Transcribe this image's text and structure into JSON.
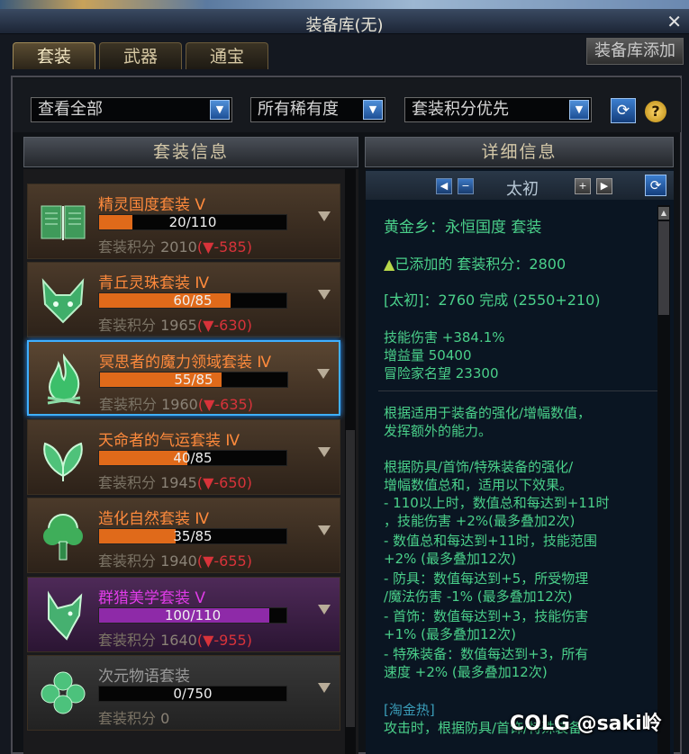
{
  "window": {
    "title": "装备库(无)",
    "close": "✕"
  },
  "tabs": [
    {
      "label": "套装"
    },
    {
      "label": "武器"
    },
    {
      "label": "通宝"
    }
  ],
  "top_button": "装备库添加",
  "filters": {
    "view": "查看全部",
    "rarity": "所有稀有度",
    "sort": "套装积分优先"
  },
  "left_header": "套装信息",
  "right_header": "详细信息",
  "sets": [
    {
      "name": "精灵国度套装 Ⅴ",
      "progress": "20/110",
      "fraction": 0.18,
      "score_label": "套装积分",
      "score": "2010",
      "diff": "(▼-585)",
      "color": "#ff8a3c",
      "fill": "#e06a1a",
      "icon": "book-icon"
    },
    {
      "name": "青丘灵珠套装 Ⅳ",
      "progress": "60/85",
      "fraction": 0.7,
      "score_label": "套装积分",
      "score": "1965",
      "diff": "(▼-630)",
      "color": "#ff8a3c",
      "fill": "#e06a1a",
      "icon": "fox-icon"
    },
    {
      "name": "冥思者的魔力领域套装 Ⅳ",
      "progress": "55/85",
      "fraction": 0.65,
      "score_label": "套装积分",
      "score": "1960",
      "diff": "(▼-635)",
      "color": "#ff8a3c",
      "fill": "#e06a1a",
      "icon": "flame-icon"
    },
    {
      "name": "天命者的气运套装 Ⅳ",
      "progress": "40/85",
      "fraction": 0.47,
      "score_label": "套装积分",
      "score": "1945",
      "diff": "(▼-650)",
      "color": "#ff8a3c",
      "fill": "#e06a1a",
      "icon": "leaf-icon"
    },
    {
      "name": "造化自然套装 Ⅳ",
      "progress": "35/85",
      "fraction": 0.41,
      "score_label": "套装积分",
      "score": "1940",
      "diff": "(▼-655)",
      "color": "#ff8a3c",
      "fill": "#e06a1a",
      "icon": "tree-icon"
    },
    {
      "name": "群猎美学套装 Ⅴ",
      "progress": "100/110",
      "fraction": 0.91,
      "score_label": "套装积分",
      "score": "1640",
      "diff": "(▼-955)",
      "color": "#e03ce8",
      "fill": "#8e2aa8",
      "icon": "wolf-icon"
    },
    {
      "name": "次元物语套装",
      "progress": "0/750",
      "fraction": 0,
      "score_label": "套装积分",
      "score": "0",
      "diff": "",
      "color": "#9a9a9a",
      "fill": "#555555",
      "icon": "clover-icon"
    }
  ],
  "detail": {
    "nav_title": "太初",
    "set_title": "黄金乡：永恒国度  套装",
    "added": "已添加的 套装积分：2800",
    "grade": "[太初]：2760 完成 (2550+210)",
    "stats": [
      "技能伤害 +384.1%",
      "增益量 50400",
      "冒险家名望 23300"
    ],
    "desc": [
      "根据适用于装备的强化/增幅数值，",
      "发挥额外的能力。"
    ],
    "rules": [
      "根据防具/首饰/特殊装备的强化/",
      "增幅数值总和，适用以下效果。",
      "- 110以上时，数值总和每达到+11时",
      "，技能伤害 +2%(最多叠加2次)",
      "- 数值总和每达到+11时，技能范围",
      "+2% (最多叠加12次)",
      "- 防具：数值每达到+5，所受物理",
      "/魔法伤害 -1% (最多叠加12次)",
      "- 首饰：数值每达到+3，技能伤害",
      "+1% (最多叠加12次)",
      "- 特殊装备：数值每达到+3，所有",
      "速度 +2% (最多叠加12次)"
    ],
    "extra_title": "[淘金热]",
    "extra_line": "攻击时，根据防具/首饰/特殊装备"
  },
  "watermark": "COLG @saki岭"
}
